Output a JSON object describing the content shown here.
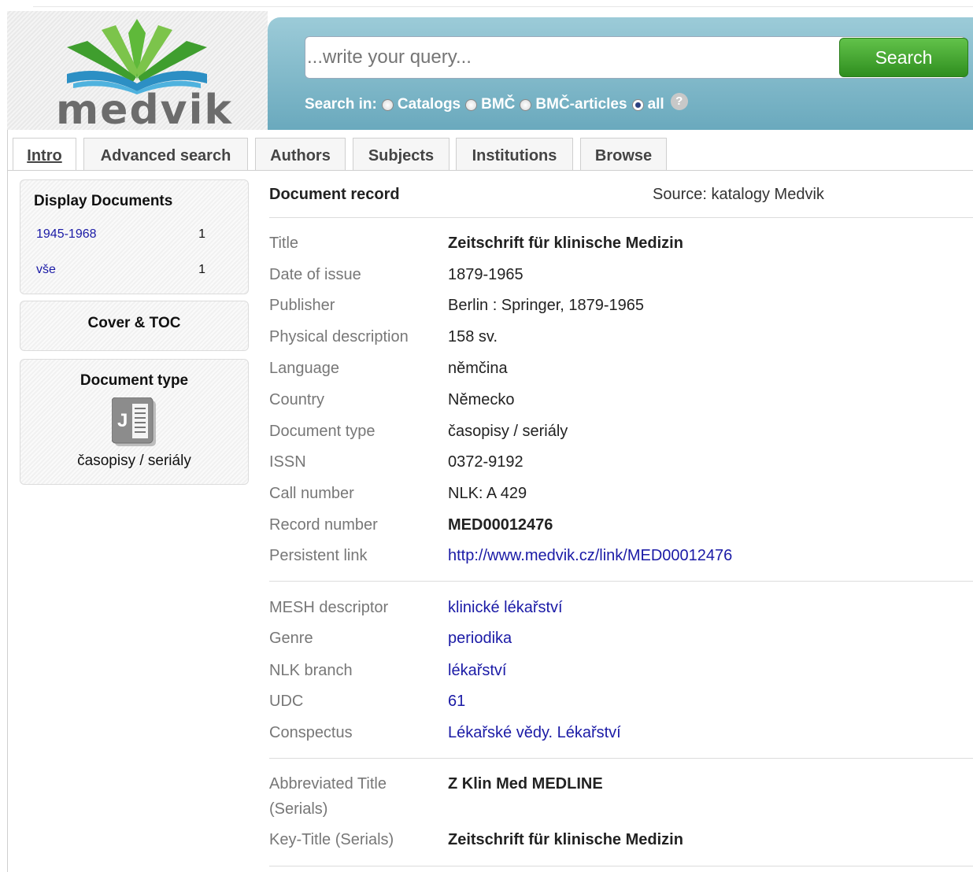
{
  "header": {
    "logo_text": "medvik",
    "search_placeholder": "...write your query...",
    "search_button": "Search",
    "search_in_label": "Search in:",
    "search_options": [
      {
        "label": "Catalogs",
        "checked": false
      },
      {
        "label": "BMČ",
        "checked": false
      },
      {
        "label": "BMČ-articles",
        "checked": false
      },
      {
        "label": "all",
        "checked": true
      }
    ],
    "help_glyph": "?"
  },
  "tabs": [
    "Intro",
    "Advanced search",
    "Authors",
    "Subjects",
    "Institutions",
    "Browse"
  ],
  "sidebar": {
    "display_documents": {
      "title": "Display Documents",
      "items": [
        {
          "label": "1945-1968",
          "count": "1"
        },
        {
          "label": "vše",
          "count": "1"
        }
      ]
    },
    "cover_toc": {
      "title": "Cover & TOC"
    },
    "document_type": {
      "title": "Document type",
      "icon_letter": "J",
      "value": "časopisy / seriály"
    }
  },
  "record": {
    "heading": "Document record",
    "source": "Source: katalogy Medvik",
    "group1": [
      {
        "label": "Title",
        "value": "Zeitschrift für klinische Medizin",
        "style": "bold"
      },
      {
        "label": "Date of issue",
        "value": "1879-1965",
        "style": "plain"
      },
      {
        "label": "Publisher",
        "value": "Berlin : Springer, 1879-1965",
        "style": "plain"
      },
      {
        "label": "Physical description",
        "value": "158 sv.",
        "style": "plain"
      },
      {
        "label": "Language",
        "value": "němčina",
        "style": "plain"
      },
      {
        "label": "Country",
        "value": "Německo",
        "style": "plain"
      },
      {
        "label": "Document type",
        "value": "časopisy / seriály",
        "style": "plain"
      },
      {
        "label": "ISSN",
        "value": "0372-9192",
        "style": "plain"
      },
      {
        "label": "Call number",
        "value": "NLK: A 429",
        "style": "plain"
      },
      {
        "label": "Record number",
        "value": "MED00012476",
        "style": "bold"
      },
      {
        "label": "Persistent link",
        "value": "http://www.medvik.cz/link/MED00012476",
        "style": "link"
      }
    ],
    "group2": [
      {
        "label": "MESH descriptor",
        "value": "klinické lékařství",
        "style": "link"
      },
      {
        "label": "Genre",
        "value": "periodika",
        "style": "link"
      },
      {
        "label": "NLK branch",
        "value": "lékařství",
        "style": "link"
      },
      {
        "label": "UDC",
        "value": "61",
        "style": "link"
      },
      {
        "label": "Conspectus",
        "value": "Lékařské vědy. Lékařství",
        "style": "link"
      }
    ],
    "group3": [
      {
        "label": "Abbreviated Title (Serials)",
        "label_line1": "Abbreviated Title",
        "label_line2": "(Serials)",
        "value": "Z Klin Med MEDLINE",
        "style": "bold"
      },
      {
        "label": "Key-Title (Serials)",
        "value": "Zeitschrift für klinische Medizin",
        "style": "bold"
      }
    ]
  }
}
